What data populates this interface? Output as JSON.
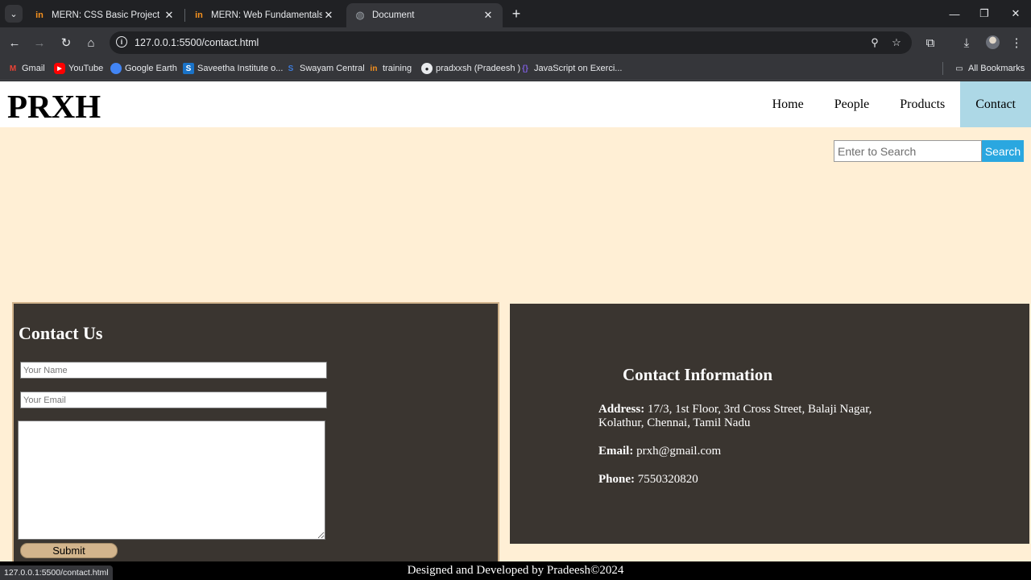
{
  "browser": {
    "tabs": [
      {
        "title": "MERN: CSS Basic Project | SEC",
        "favicon": "in",
        "active": false
      },
      {
        "title": "MERN: Web Fundamentals and",
        "favicon": "in",
        "active": false
      },
      {
        "title": "Document",
        "favicon": "globe",
        "active": true
      }
    ],
    "url": "127.0.0.1:5500/contact.html",
    "bookmarks": [
      {
        "label": "Gmail",
        "icon": "gmail-icon"
      },
      {
        "label": "YouTube",
        "icon": "youtube-icon"
      },
      {
        "label": "Google Earth",
        "icon": "google-earth-icon"
      },
      {
        "label": "Saveetha Institute o...",
        "icon": "saveetha-icon"
      },
      {
        "label": "Swayam Central",
        "icon": "swayam-icon"
      },
      {
        "label": "training",
        "icon": "training-icon"
      },
      {
        "label": "pradxxsh (Pradeesh )",
        "icon": "github-icon"
      },
      {
        "label": "JavaScript on Exerci...",
        "icon": "exercism-icon"
      }
    ],
    "all_bookmarks_label": "All Bookmarks",
    "status_url": "127.0.0.1:5500/contact.html"
  },
  "site": {
    "logo": "PRXH",
    "nav": [
      {
        "label": "Home",
        "active": false
      },
      {
        "label": "People",
        "active": false
      },
      {
        "label": "Products",
        "active": false
      },
      {
        "label": "Contact",
        "active": true
      }
    ],
    "search": {
      "placeholder": "Enter to Search",
      "button_label": "Search"
    },
    "contact_form": {
      "title": "Contact Us",
      "name_placeholder": "Your Name",
      "email_placeholder": "Your Email",
      "submit_label": "Submit"
    },
    "contact_info": {
      "title": "Contact Information",
      "address_label": "Address:",
      "address_line1": "17/3, 1st Floor, 3rd Cross Street, Balaji Nagar,",
      "address_line2": "Kolathur, Chennai, Tamil Nadu",
      "email_label": "Email:",
      "email": "prxh@gmail.com",
      "phone_label": "Phone:",
      "phone": "7550320820"
    },
    "footer": "Designed and Developed by Pradeesh©2024"
  },
  "colors": {
    "page_bg": "#ffefd5",
    "panel_bg": "#3a3530",
    "nav_active": "#add8e6",
    "search_button": "#2aa7e0",
    "accent_tan": "#d2b48c"
  }
}
